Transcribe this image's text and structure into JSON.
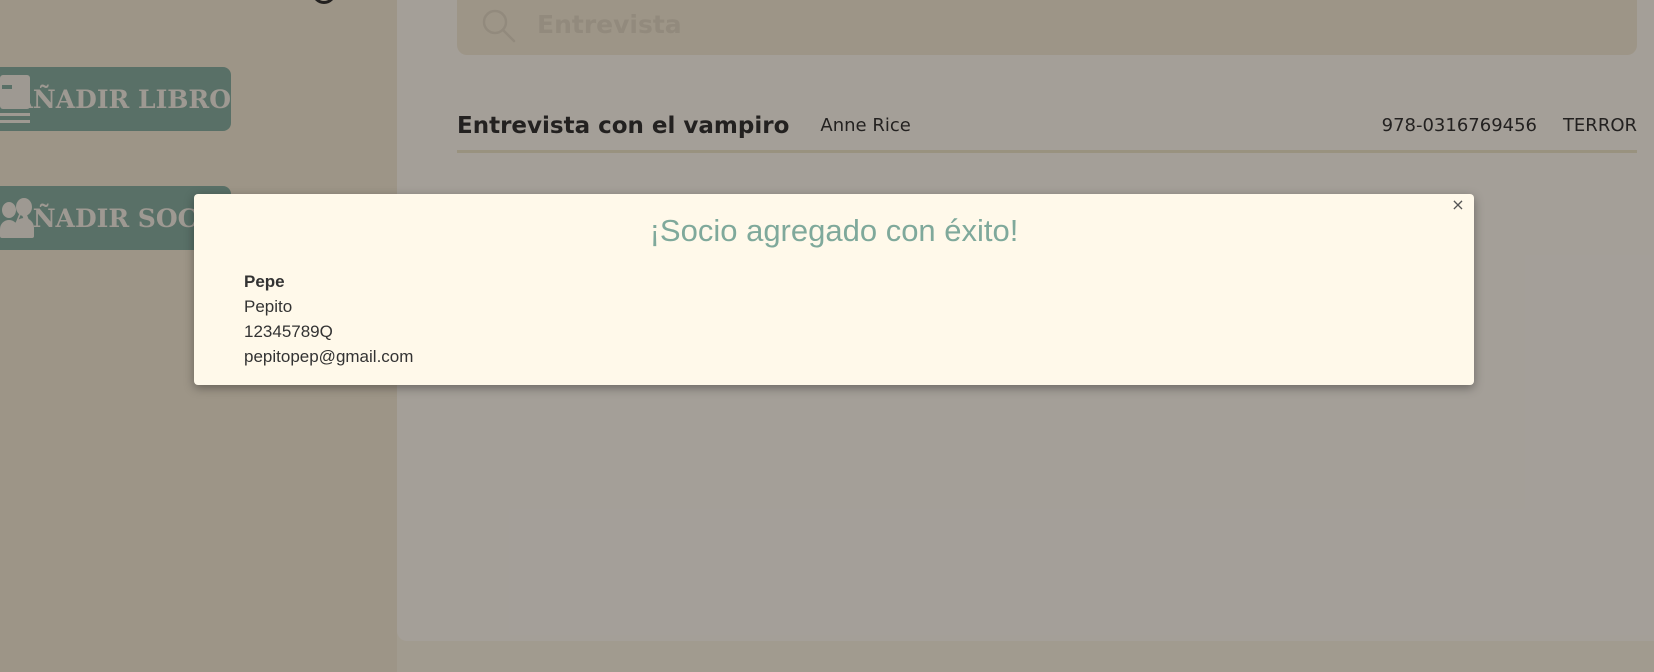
{
  "sidebar": {
    "add_book_label": "AÑADIR LIBRO",
    "add_member_label": "AÑADIR SOCIO"
  },
  "search": {
    "query": "Entrevista"
  },
  "results": [
    {
      "title": "Entrevista con el vampiro",
      "author": "Anne Rice",
      "isbn": "978-0316769456",
      "genre": "TERROR"
    }
  ],
  "modal": {
    "title": "¡Socio agregado con éxito!",
    "close_glyph": "×",
    "member": {
      "name": "Pepe",
      "surname": "Pepito",
      "dni": "12345789Q",
      "email": "pepitopep@gmail.com"
    }
  },
  "colors": {
    "accent": "#7fa99b",
    "sidebar_bg": "#f3e9d2",
    "main_bg": "#fffaf0",
    "modal_bg": "#fff9ea"
  }
}
